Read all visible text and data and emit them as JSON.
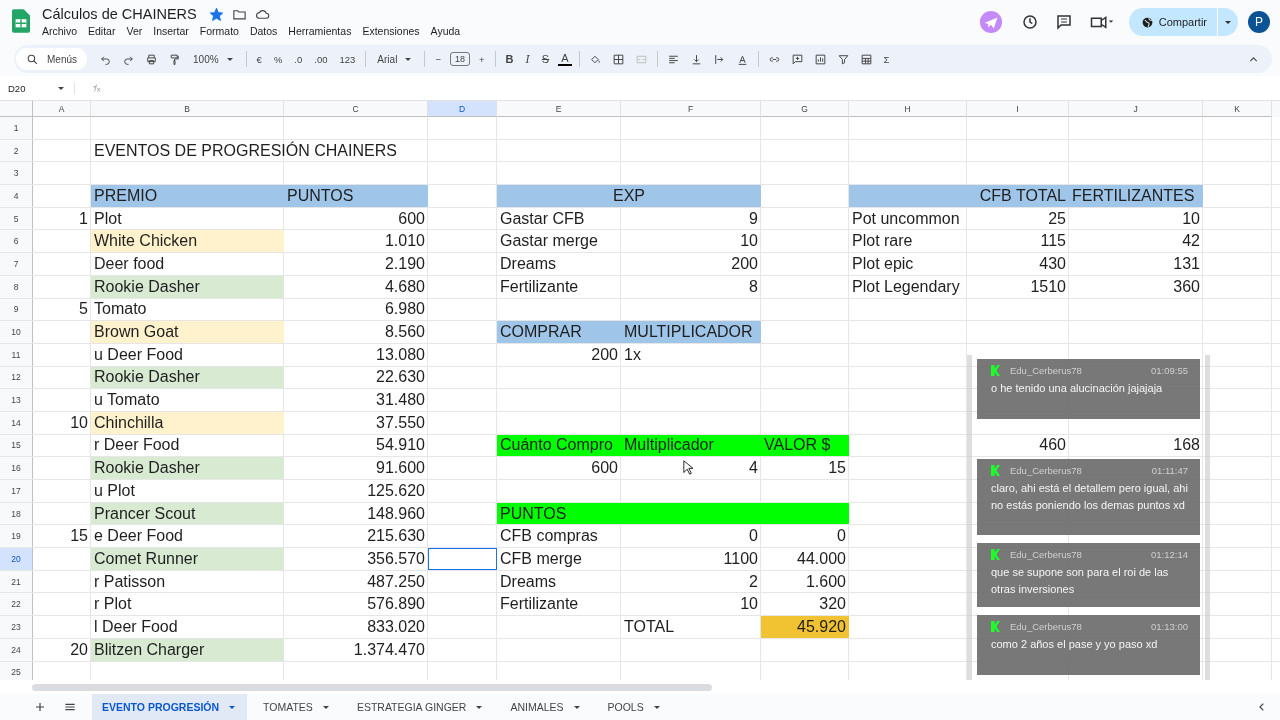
{
  "document": {
    "title": "Cálculos de CHAINERS",
    "starred": true
  },
  "menu": [
    "Archivo",
    "Editar",
    "Ver",
    "Insertar",
    "Formato",
    "Datos",
    "Herramientas",
    "Extensiones",
    "Ayuda"
  ],
  "share_button": {
    "label": "Compartir"
  },
  "account": {
    "initial": "P"
  },
  "toolbar": [
    [
      {
        "kind": "search",
        "label": "Menús"
      },
      {
        "kind": "icon"
      },
      {
        "kind": "icon"
      },
      {
        "kind": "icon"
      },
      {
        "kind": "icon"
      },
      {
        "kind": "dropdown",
        "label": "100%"
      }
    ],
    [
      {
        "kind": "text",
        "label": "€"
      },
      {
        "kind": "text",
        "label": "%"
      },
      {
        "kind": "text",
        "label": ".0"
      },
      {
        "kind": "text",
        "label": ".00"
      },
      {
        "kind": "text",
        "label": "123"
      }
    ],
    [
      {
        "kind": "dropdown",
        "label": "Arial"
      }
    ],
    [
      {
        "kind": "text",
        "label": "−"
      },
      {
        "kind": "size",
        "label": "18"
      },
      {
        "kind": "text",
        "label": "+"
      }
    ],
    [
      {
        "kind": "bold",
        "label": "B"
      },
      {
        "kind": "italic",
        "label": "I"
      },
      {
        "kind": "strike",
        "label": "S"
      },
      {
        "kind": "underline",
        "label": "A"
      }
    ],
    [
      {
        "kind": "icon"
      },
      {
        "kind": "icon"
      },
      {
        "kind": "icon"
      }
    ],
    [
      {
        "kind": "icon"
      },
      {
        "kind": "icon"
      },
      {
        "kind": "icon"
      },
      {
        "kind": "icon"
      }
    ],
    [
      {
        "kind": "icon"
      },
      {
        "kind": "icon"
      },
      {
        "kind": "icon"
      },
      {
        "kind": "icon"
      },
      {
        "kind": "icon"
      },
      {
        "kind": "text",
        "label": "Σ"
      }
    ]
  ],
  "name_box": "D20",
  "columns": [
    {
      "label": "A",
      "selected": false
    },
    {
      "label": "B",
      "selected": false
    },
    {
      "label": "C",
      "selected": false
    },
    {
      "label": "D",
      "selected": true
    },
    {
      "label": "E",
      "selected": false
    },
    {
      "label": "F",
      "selected": false
    },
    {
      "label": "G",
      "selected": false
    },
    {
      "label": "H",
      "selected": false
    },
    {
      "label": "I",
      "selected": false
    },
    {
      "label": "J",
      "selected": false
    },
    {
      "label": "K",
      "selected": false
    }
  ],
  "rows": [
    {
      "number": "1",
      "selected": false,
      "cells": []
    },
    {
      "number": "2",
      "selected": false,
      "cells": [
        null,
        {
          "text": "EVENTOS DE PROGRESIÓN CHAINERS",
          "kind": "wide"
        }
      ]
    },
    {
      "number": "3",
      "selected": false,
      "cells": []
    },
    {
      "number": "4",
      "selected": false,
      "cells": [
        null,
        {
          "text": "PREMIO",
          "kind": "text",
          "color": "#9fc5e8"
        },
        {
          "text": "PUNTOS",
          "kind": "text",
          "color": "#9fc5e8"
        },
        null,
        {
          "text": "EXP",
          "kind": "merged",
          "color": "#9fc5e8"
        },
        null,
        null,
        {
          "kind": "text",
          "color": "#9fc5e8"
        },
        {
          "text": "CFB TOTAL",
          "kind": "number",
          "color": "#9fc5e8"
        },
        {
          "text": "FERTILIZANTES",
          "kind": "text",
          "color": "#9fc5e8"
        }
      ]
    },
    {
      "number": "5",
      "selected": false,
      "cells": [
        {
          "text": "1",
          "kind": "number"
        },
        {
          "text": "Plot",
          "kind": "text"
        },
        {
          "text": "600",
          "kind": "number"
        },
        null,
        {
          "text": "Gastar CFB",
          "kind": "text"
        },
        {
          "text": "9",
          "kind": "number"
        },
        null,
        {
          "text": "Pot uncommon",
          "kind": "text"
        },
        {
          "text": "25",
          "kind": "number"
        },
        {
          "text": "10",
          "kind": "number"
        }
      ]
    },
    {
      "number": "6",
      "selected": false,
      "cells": [
        null,
        {
          "text": "White Chicken",
          "kind": "text",
          "color": "#fff2cc"
        },
        {
          "text": "1.010",
          "kind": "number"
        },
        null,
        {
          "text": "Gastar merge",
          "kind": "text"
        },
        {
          "text": "10",
          "kind": "number"
        },
        null,
        {
          "text": "Plot rare",
          "kind": "text"
        },
        {
          "text": "115",
          "kind": "number"
        },
        {
          "text": "42",
          "kind": "number"
        }
      ]
    },
    {
      "number": "7",
      "selected": false,
      "cells": [
        null,
        {
          "text": "Deer food",
          "kind": "text"
        },
        {
          "text": "2.190",
          "kind": "number"
        },
        null,
        {
          "text": "Dreams",
          "kind": "text"
        },
        {
          "text": "200",
          "kind": "number"
        },
        null,
        {
          "text": "Plot epic",
          "kind": "text"
        },
        {
          "text": "430",
          "kind": "number"
        },
        {
          "text": "131",
          "kind": "number"
        }
      ]
    },
    {
      "number": "8",
      "selected": false,
      "cells": [
        null,
        {
          "text": "Rookie Dasher",
          "kind": "text",
          "color": "#d9ead3"
        },
        {
          "text": "4.680",
          "kind": "number"
        },
        null,
        {
          "text": "Fertilizante",
          "kind": "text"
        },
        {
          "text": "8",
          "kind": "number"
        },
        null,
        {
          "text": "Plot Legendary",
          "kind": "text"
        },
        {
          "text": "1510",
          "kind": "number"
        },
        {
          "text": "360",
          "kind": "number"
        }
      ]
    },
    {
      "number": "9",
      "selected": false,
      "cells": [
        {
          "text": "5",
          "kind": "number"
        },
        {
          "text": "Tomato",
          "kind": "text"
        },
        {
          "text": "6.980",
          "kind": "number"
        }
      ]
    },
    {
      "number": "10",
      "selected": false,
      "cells": [
        null,
        {
          "text": "Brown Goat",
          "kind": "text",
          "color": "#fff2cc"
        },
        {
          "text": "8.560",
          "kind": "number"
        },
        null,
        {
          "text": "COMPRAR",
          "kind": "text",
          "color": "#9fc5e8"
        },
        {
          "text": "MULTIPLICADOR",
          "kind": "text",
          "color": "#9fc5e8"
        }
      ]
    },
    {
      "number": "11",
      "selected": false,
      "cells": [
        null,
        {
          "text": "u Deer Food",
          "kind": "text"
        },
        {
          "text": "13.080",
          "kind": "number"
        },
        null,
        {
          "text": "200",
          "kind": "number"
        },
        {
          "text": "1x",
          "kind": "text"
        }
      ]
    },
    {
      "number": "12",
      "selected": false,
      "cells": [
        null,
        {
          "text": "Rookie Dasher",
          "kind": "text",
          "color": "#d9ead3"
        },
        {
          "text": "22.630",
          "kind": "number"
        }
      ]
    },
    {
      "number": "13",
      "selected": false,
      "cells": [
        null,
        {
          "text": "u Tomato",
          "kind": "text"
        },
        {
          "text": "31.480",
          "kind": "number"
        }
      ]
    },
    {
      "number": "14",
      "selected": false,
      "cells": [
        {
          "text": "10",
          "kind": "number"
        },
        {
          "text": "Chinchilla",
          "kind": "text",
          "color": "#fff2cc"
        },
        {
          "text": "37.550",
          "kind": "number"
        }
      ]
    },
    {
      "number": "15",
      "selected": false,
      "cells": [
        null,
        {
          "text": "r Deer Food",
          "kind": "text"
        },
        {
          "text": "54.910",
          "kind": "number"
        },
        null,
        {
          "text": "Cuánto Compro",
          "kind": "text",
          "color": "#00ff00"
        },
        {
          "text": "Multiplicador",
          "kind": "text",
          "color": "#00ff00"
        },
        {
          "text": "VALOR $",
          "kind": "text",
          "color": "#00ff00"
        },
        null,
        {
          "text": "460",
          "kind": "number"
        },
        {
          "text": "168",
          "kind": "number"
        }
      ]
    },
    {
      "number": "16",
      "selected": false,
      "cells": [
        null,
        {
          "text": "Rookie Dasher",
          "kind": "text",
          "color": "#d9ead3"
        },
        {
          "text": "91.600",
          "kind": "number"
        },
        null,
        {
          "text": "600",
          "kind": "number"
        },
        {
          "text": "4",
          "kind": "number"
        },
        {
          "text": "15",
          "kind": "number"
        }
      ]
    },
    {
      "number": "17",
      "selected": false,
      "cells": [
        null,
        {
          "text": "u Plot",
          "kind": "text"
        },
        {
          "text": "125.620",
          "kind": "number"
        }
      ]
    },
    {
      "number": "18",
      "selected": false,
      "cells": [
        null,
        {
          "text": "Prancer Scout",
          "kind": "text",
          "color": "#d9ead3"
        },
        {
          "text": "148.960",
          "kind": "number"
        },
        null,
        {
          "text": "PUNTOS",
          "kind": "text",
          "color": "#00ff00"
        },
        {
          "kind": "text",
          "color": "#00ff00"
        },
        {
          "kind": "text",
          "color": "#00ff00"
        }
      ]
    },
    {
      "number": "19",
      "selected": false,
      "cells": [
        {
          "text": "15",
          "kind": "number"
        },
        {
          "text": "e Deer Food",
          "kind": "text"
        },
        {
          "text": "215.630",
          "kind": "number"
        },
        null,
        {
          "text": "CFB compras",
          "kind": "text"
        },
        {
          "text": "0",
          "kind": "number"
        },
        {
          "text": "0",
          "kind": "number"
        }
      ]
    },
    {
      "number": "20",
      "selected": true,
      "cells": [
        null,
        {
          "text": "Comet Runner",
          "kind": "text",
          "color": "#d9ead3"
        },
        {
          "text": "356.570",
          "kind": "number"
        },
        null,
        {
          "text": "CFB merge",
          "kind": "text"
        },
        {
          "text": "1100",
          "kind": "number"
        },
        {
          "text": "44.000",
          "kind": "number"
        }
      ]
    },
    {
      "number": "21",
      "selected": false,
      "cells": [
        null,
        {
          "text": "r Patisson",
          "kind": "text"
        },
        {
          "text": "487.250",
          "kind": "number"
        },
        null,
        {
          "text": "Dreams",
          "kind": "text"
        },
        {
          "text": "2",
          "kind": "number"
        },
        {
          "text": "1.600",
          "kind": "number"
        }
      ]
    },
    {
      "number": "22",
      "selected": false,
      "cells": [
        null,
        {
          "text": "r Plot",
          "kind": "text"
        },
        {
          "text": "576.890",
          "kind": "number"
        },
        null,
        {
          "text": "Fertilizante",
          "kind": "text"
        },
        {
          "text": "10",
          "kind": "number"
        },
        {
          "text": "320",
          "kind": "number"
        }
      ]
    },
    {
      "number": "23",
      "selected": false,
      "cells": [
        null,
        {
          "text": "l Deer Food",
          "kind": "text"
        },
        {
          "text": "833.020",
          "kind": "number"
        },
        null,
        null,
        {
          "text": "TOTAL",
          "kind": "text"
        },
        {
          "text": "45.920",
          "kind": "number",
          "color": "#f1c232"
        }
      ]
    },
    {
      "number": "24",
      "selected": false,
      "cells": [
        {
          "text": "20",
          "kind": "number"
        },
        {
          "text": "Blitzen Charger",
          "kind": "text",
          "color": "#d9ead3"
        },
        {
          "text": "1.374.470",
          "kind": "number"
        }
      ]
    },
    {
      "number": "25",
      "selected": false,
      "cells": []
    }
  ],
  "chat": [
    {
      "user": "Edu_Cerberus78",
      "time": "01:09:55",
      "text": "o he tenido una alucinación jajajaja"
    },
    {
      "user": "Edu_Cerberus78",
      "time": "01:11:47",
      "text": "claro, ahi está el detallem pero igual, ahi no estás poniendo los demas puntos xd"
    },
    {
      "user": "Edu_Cerberus78",
      "time": "01:12:14",
      "text": "que se supone son para el roi de las otras inversiones"
    },
    {
      "user": "Edu_Cerberus78",
      "time": "01:13:00",
      "text": "como 2 años el pase y yo paso xd"
    }
  ],
  "sheet_tabs": [
    {
      "label": "EVENTO PROGRESIÓN",
      "selected": true
    },
    {
      "label": "TOMATES",
      "selected": false
    },
    {
      "label": "ESTRATEGIA GINGER",
      "selected": false
    },
    {
      "label": "ANIMALES",
      "selected": false
    },
    {
      "label": "POOLS",
      "selected": false
    }
  ]
}
